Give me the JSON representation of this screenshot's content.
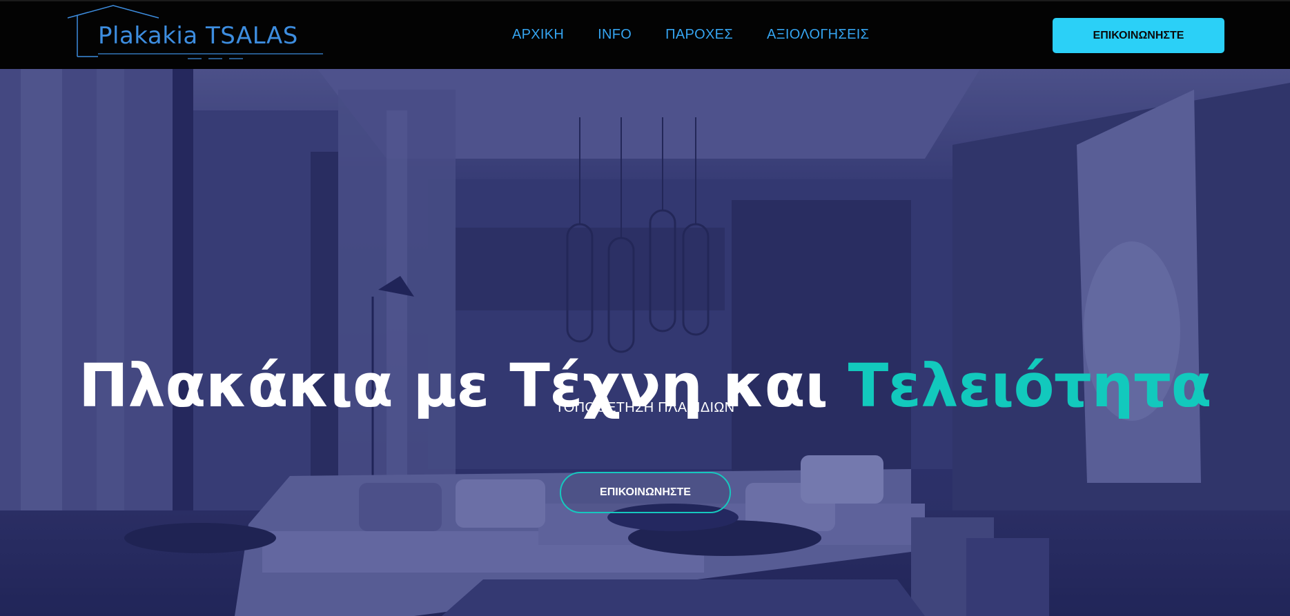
{
  "header": {
    "logo_text": "Plakakia TSALAS",
    "nav": [
      "ΑΡΧΙΚΗ",
      "INFO",
      "ΠΑΡΟΧΕΣ",
      "ΑΞΙΟΛΟΓΗΣΕΙΣ"
    ],
    "cta_label": "ΕΠΙΚΟΙΝΩΝΗΣΤΕ"
  },
  "hero": {
    "title_main": "Πλακάκια με Τέχνη και ",
    "title_accent": "Τελειότητα",
    "subtitle": "ΤΟΠΟΘΕΤΗΣΗ ΠΛΑΚΙΔΙΩΝ",
    "cta_label": "ΕΠΙΚΟΙΝΩΝΗΣΤΕ"
  },
  "colors": {
    "header_bg": "#030303",
    "logo": "#3d8ddf",
    "nav_link": "#35a4f0",
    "header_button": "#2bd0f7",
    "accent": "#12c9bd",
    "hero_overlay": "#2f3468"
  }
}
